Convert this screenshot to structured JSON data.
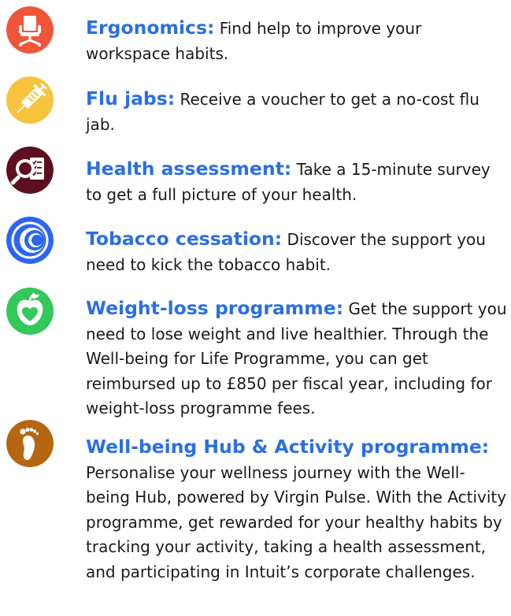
{
  "items": [
    {
      "title": "Ergonomics:",
      "description": "Find help to improve your workspace habits.",
      "icon": "office-chair-icon",
      "icon_color": "#f0553a"
    },
    {
      "title": "Flu jabs:",
      "description": "Receive a voucher to get a no-cost flu jab.",
      "icon": "syringe-icon",
      "icon_color": "#f7c33f"
    },
    {
      "title": "Health assessment:",
      "description": "Take a 15-minute survey to get a full picture of your health.",
      "icon": "magnifier-checklist-icon",
      "icon_color": "#5e0f1f"
    },
    {
      "title": "Tobacco cessation:",
      "description": "Discover the support you need to kick the tobacco habit.",
      "icon": "swirl-icon",
      "icon_color": "#2a66f0"
    },
    {
      "title": "Weight-loss programme:",
      "description": "Get the support you need to lose weight and live healthier. Through the Well-being for Life Programme, you can get reimbursed up to £850 per fiscal year, including for weight-loss programme fees.",
      "icon": "apple-heart-icon",
      "icon_color": "#32c85a"
    },
    {
      "title": "Well-being Hub & Activity programme:",
      "description": "Personalise your wellness journey with the Well-being Hub, powered by Virgin Pulse. With the Activity programme, get rewarded for your healthy habits by tracking your activity, taking a health assessment, and participating in Intuit’s corporate challenges.",
      "icon": "footprint-icon",
      "icon_color": "#b66510"
    }
  ]
}
